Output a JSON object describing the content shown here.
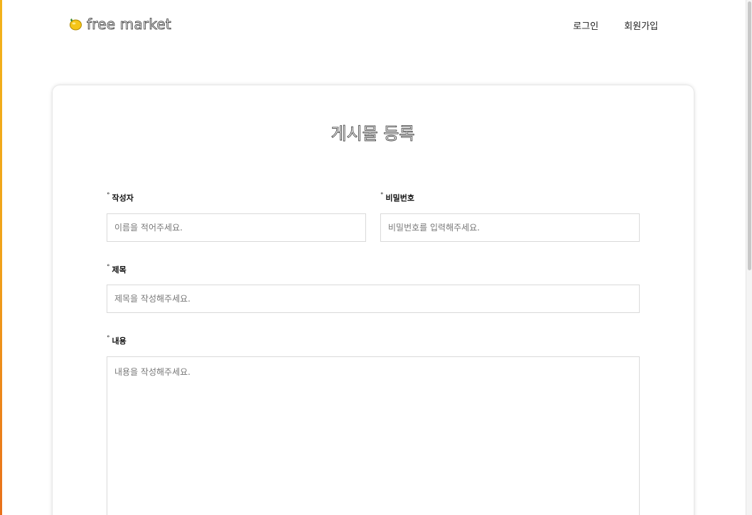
{
  "header": {
    "logo_text": "free market",
    "nav": {
      "login": "로그인",
      "signup": "회원가입"
    }
  },
  "form": {
    "title": "게시물 등록",
    "writer": {
      "label": "작성자",
      "placeholder": "이름을 적어주세요."
    },
    "password": {
      "label": "비밀번호",
      "placeholder": "비밀번호를 입력해주세요."
    },
    "subject": {
      "label": "제목",
      "placeholder": "제목을 작성해주세요."
    },
    "contents": {
      "label": "내용",
      "placeholder": "내용을 작성해주세요."
    },
    "required_mark": "°"
  },
  "colors": {
    "accent_left_edge": "#f0a21a",
    "lemon": "#f5c518"
  },
  "icons": {
    "logo": "lemon-icon"
  }
}
